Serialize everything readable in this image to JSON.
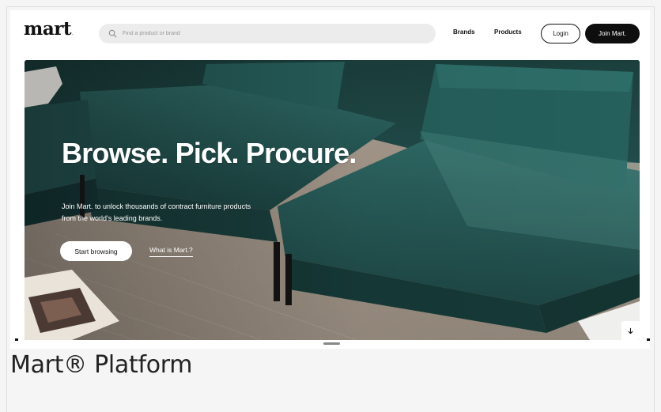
{
  "header": {
    "logo_text": "mart",
    "logo_mark": ".",
    "search": {
      "placeholder": "Find a product or brand",
      "icon": "search-icon"
    },
    "nav": [
      {
        "label": "Brands"
      },
      {
        "label": "Products"
      }
    ],
    "login_label": "Login",
    "join_label": "Join Mart."
  },
  "hero": {
    "title": "Browse. Pick. Procure.",
    "subtitle": "Join Mart. to unlock thousands of contract furniture products from the world's leading brands.",
    "cta_primary": "Start browsing",
    "cta_secondary": "What is Mart.?",
    "scroll_icon": "arrow-down-icon"
  },
  "caption": "Mart® Platform",
  "colors": {
    "sofa": "#1f4a48",
    "sofa_light": "#2f6663",
    "floor": "#a6998c",
    "dark": "#0e0e0e",
    "background": "#f5f5f5"
  }
}
